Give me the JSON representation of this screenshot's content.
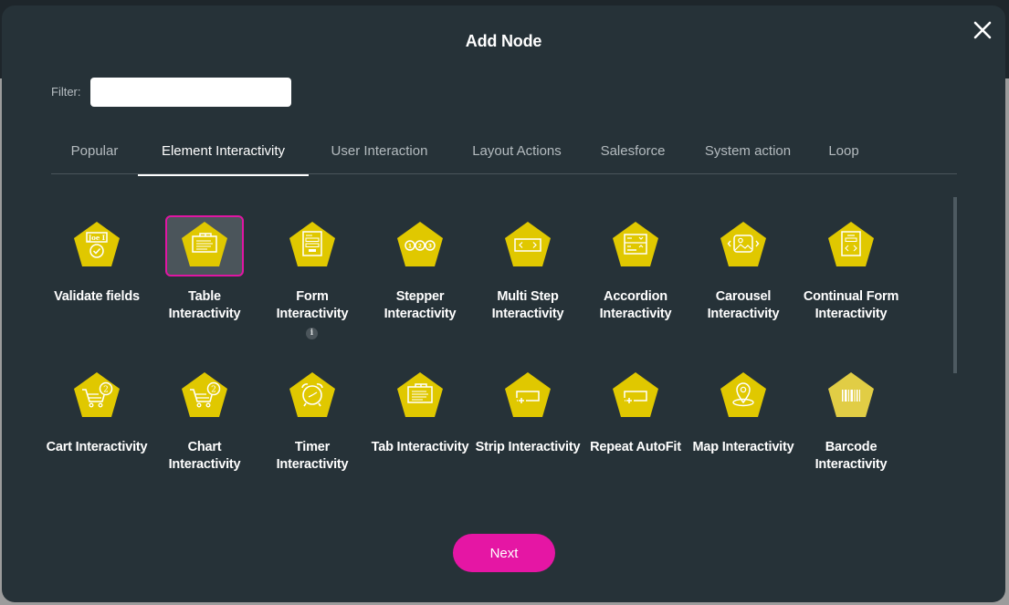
{
  "dialog": {
    "title": "Add Node",
    "close_icon": "close-x-icon"
  },
  "filter": {
    "label": "Filter:",
    "value": "",
    "placeholder": ""
  },
  "tabs": [
    {
      "label": "Popular",
      "active": false
    },
    {
      "label": "Element Interactivity",
      "active": true
    },
    {
      "label": "User Interaction",
      "active": false
    },
    {
      "label": "Layout Actions",
      "active": false
    },
    {
      "label": "Salesforce",
      "active": false
    },
    {
      "label": "System action",
      "active": false
    },
    {
      "label": "Loop",
      "active": false
    }
  ],
  "nodes": [
    {
      "label": "Validate fields",
      "icon": "validate-fields-icon",
      "selected": false,
      "info": false
    },
    {
      "label": "Table Interactivity",
      "icon": "table-icon",
      "selected": true,
      "info": false
    },
    {
      "label": "Form Interactivity",
      "icon": "form-icon",
      "selected": false,
      "info": true
    },
    {
      "label": "Stepper Interactivity",
      "icon": "stepper-icon",
      "selected": false,
      "info": false
    },
    {
      "label": "Multi Step Interactivity",
      "icon": "multi-step-icon",
      "selected": false,
      "info": false
    },
    {
      "label": "Accordion Interactivity",
      "icon": "accordion-icon",
      "selected": false,
      "info": false
    },
    {
      "label": "Carousel Interactivity",
      "icon": "carousel-icon",
      "selected": false,
      "info": false
    },
    {
      "label": "Continual Form Interactivity",
      "icon": "continual-form-icon",
      "selected": false,
      "info": false
    },
    {
      "label": "Cart Interactivity",
      "icon": "cart-icon",
      "selected": false,
      "info": false
    },
    {
      "label": "Chart Interactivity",
      "icon": "chart-cart-icon",
      "selected": false,
      "info": false
    },
    {
      "label": "Timer Interactivity",
      "icon": "alarm-clock-icon",
      "selected": false,
      "info": false
    },
    {
      "label": "Tab Interactivity",
      "icon": "tab-folder-icon",
      "selected": false,
      "info": false
    },
    {
      "label": "Strip Interactivity",
      "icon": "strip-icon",
      "selected": false,
      "info": false
    },
    {
      "label": "Repeat AutoFit",
      "icon": "repeat-autofit-icon",
      "selected": false,
      "info": false
    },
    {
      "label": "Map Interactivity",
      "icon": "map-pin-icon",
      "selected": false,
      "info": false
    },
    {
      "label": "Barcode Interactivity",
      "icon": "barcode-icon",
      "selected": false,
      "info": false
    }
  ],
  "info_glyph": "i",
  "footer": {
    "next_label": "Next"
  },
  "colors": {
    "modal_bg": "#263238",
    "accent": "#e516a4",
    "node_yellow": "#e0c800",
    "node_yellow_light": "#e1cd45",
    "selected_tile_bg": "#4b555b"
  }
}
